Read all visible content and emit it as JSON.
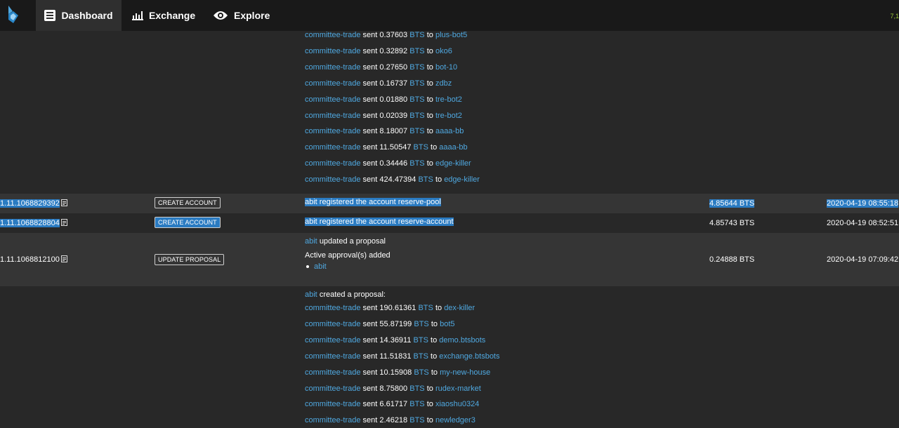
{
  "nav": {
    "tabs": [
      {
        "label": "Dashboard",
        "icon": "dashboard-icon",
        "active": true
      },
      {
        "label": "Exchange",
        "icon": "chart-icon",
        "active": false
      },
      {
        "label": "Explore",
        "icon": "eye-icon",
        "active": false
      }
    ],
    "corner_value": "7,1"
  },
  "proposal_top": {
    "lines": [
      {
        "from": "committee-trade",
        "verb": "sent",
        "amount": "0.37603",
        "asset": "BTS",
        "to_word": "to",
        "to": "plus-bot5"
      },
      {
        "from": "committee-trade",
        "verb": "sent",
        "amount": "0.32892",
        "asset": "BTS",
        "to_word": "to",
        "to": "oko6"
      },
      {
        "from": "committee-trade",
        "verb": "sent",
        "amount": "0.27650",
        "asset": "BTS",
        "to_word": "to",
        "to": "bot-10"
      },
      {
        "from": "committee-trade",
        "verb": "sent",
        "amount": "0.16737",
        "asset": "BTS",
        "to_word": "to",
        "to": "zdbz"
      },
      {
        "from": "committee-trade",
        "verb": "sent",
        "amount": "0.01880",
        "asset": "BTS",
        "to_word": "to",
        "to": "tre-bot2"
      },
      {
        "from": "committee-trade",
        "verb": "sent",
        "amount": "0.02039",
        "asset": "BTS",
        "to_word": "to",
        "to": "tre-bot2"
      },
      {
        "from": "committee-trade",
        "verb": "sent",
        "amount": "8.18007",
        "asset": "BTS",
        "to_word": "to",
        "to": "aaaa-bb"
      },
      {
        "from": "committee-trade",
        "verb": "sent",
        "amount": "11.50547",
        "asset": "BTS",
        "to_word": "to",
        "to": "aaaa-bb"
      },
      {
        "from": "committee-trade",
        "verb": "sent",
        "amount": "0.34446",
        "asset": "BTS",
        "to_word": "to",
        "to": "edge-killer"
      },
      {
        "from": "committee-trade",
        "verb": "sent",
        "amount": "424.47394",
        "asset": "BTS",
        "to_word": "to",
        "to": "edge-killer"
      }
    ]
  },
  "rows": [
    {
      "id": "1.11.1068829392",
      "type": "CREATE ACCOUNT",
      "desc": "abit registered the account reserve-pool",
      "fee": "4.85644 BTS",
      "time": "2020-04-19 08:55:18"
    },
    {
      "id": "1.11.1068828804",
      "type": "CREATE ACCOUNT",
      "desc": "abit registered the account reserve-account",
      "fee": "4.85743 BTS",
      "time": "2020-04-19 08:52:51"
    },
    {
      "id": "1.11.1068812100",
      "type": "UPDATE PROPOSAL",
      "desc_actor": "abit",
      "desc_rest": "updated a proposal",
      "desc_sub": "Active approval(s) added",
      "desc_item": "abit",
      "fee": "0.24888 BTS",
      "time": "2020-04-19 07:09:42"
    }
  ],
  "proposal_bottom": {
    "actor": "abit",
    "header_rest": "created a proposal:",
    "lines": [
      {
        "from": "committee-trade",
        "verb": "sent",
        "amount": "190.61361",
        "asset": "BTS",
        "to_word": "to",
        "to": "dex-killer"
      },
      {
        "from": "committee-trade",
        "verb": "sent",
        "amount": "55.87199",
        "asset": "BTS",
        "to_word": "to",
        "to": "bot5"
      },
      {
        "from": "committee-trade",
        "verb": "sent",
        "amount": "14.36911",
        "asset": "BTS",
        "to_word": "to",
        "to": "demo.btsbots"
      },
      {
        "from": "committee-trade",
        "verb": "sent",
        "amount": "11.51831",
        "asset": "BTS",
        "to_word": "to",
        "to": "exchange.btsbots"
      },
      {
        "from": "committee-trade",
        "verb": "sent",
        "amount": "10.15908",
        "asset": "BTS",
        "to_word": "to",
        "to": "my-new-house"
      },
      {
        "from": "committee-trade",
        "verb": "sent",
        "amount": "8.75800",
        "asset": "BTS",
        "to_word": "to",
        "to": "rudex-market"
      },
      {
        "from": "committee-trade",
        "verb": "sent",
        "amount": "6.61717",
        "asset": "BTS",
        "to_word": "to",
        "to": "xiaoshu0324"
      },
      {
        "from": "committee-trade",
        "verb": "sent",
        "amount": "2.46218",
        "asset": "BTS",
        "to_word": "to",
        "to": "newledger3"
      }
    ]
  },
  "colors": {
    "background": "#282828",
    "row_alt": "#353535",
    "topbar": "#191919",
    "link": "#4fa8e0",
    "selection": "#2a7bc2"
  }
}
